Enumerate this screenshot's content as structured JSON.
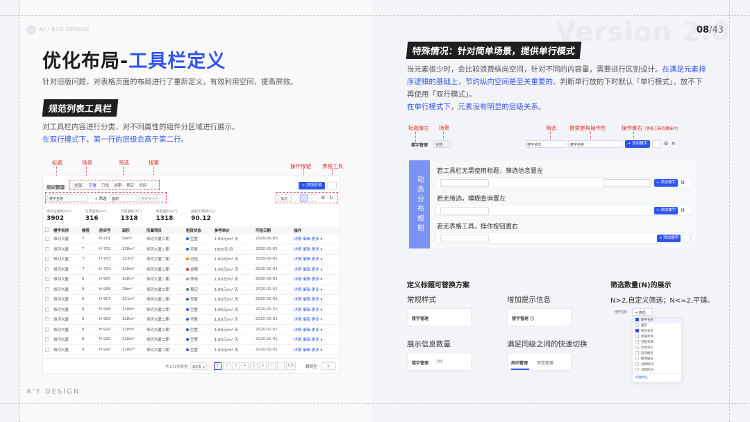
{
  "page": {
    "number": "08",
    "total": "/43",
    "version_watermark": "Version 2.0",
    "brand_watermark": "AI / B2B DESIGN"
  },
  "left": {
    "title_plain": "优化布局-",
    "title_blue": "工具栏定义",
    "intro": "针对旧版问题，对表格页面的布局进行了重新定义，有效利用空间，提高屏效。",
    "section_tag": "规范列表工具栏",
    "section_desc": "对工具栏内容进行分类，对不同属性的组件分区域进行展示。",
    "section_desc_blue": "在双行模式下，第一行的层级会高于第二行。",
    "annotations": {
      "title": "标题",
      "scene": "场景",
      "filter": "筛选",
      "search": "搜索",
      "action": "操作按钮",
      "table_tool": "表格工具"
    },
    "mock": {
      "title": "房间管理",
      "scene_tabs": [
        "全部",
        "空置",
        "已租",
        "逾期",
        "预定",
        "停用"
      ],
      "add_btn": "+ 添加房源",
      "filter_btn": "+ 筛选",
      "filter_chips": [
        "楼宇名称",
        "面积"
      ],
      "search_placeholder": "搜索房间号",
      "batch_btn": "批次",
      "stats": [
        {
          "label": "房间总面积(m²)",
          "value": "3902"
        },
        {
          "label": "空置面积(m²)",
          "value": "316"
        },
        {
          "label": "已租面积(m²)",
          "value": "1318"
        },
        {
          "label": "房租面积(m²)",
          "value": "1318"
        },
        {
          "label": "面积出租率(%)",
          "value": "90.12"
        }
      ],
      "columns": [
        "楼宇名称",
        "楼层",
        "房间号",
        "面积",
        "所属项目",
        "租赁状态",
        "参考单价",
        "可租日期",
        "操作"
      ],
      "rows": [
        [
          "恒河大厦",
          "7",
          "H-701",
          "38m²",
          "恒河大厦二期",
          "空置",
          "1.80元/m²·天",
          "2020-01-03"
        ],
        [
          "恒河大厦",
          "7",
          "H-702",
          "128m²",
          "恒河大厦二期",
          "空置",
          "1800元/月",
          "2020-01-01"
        ],
        [
          "恒河大厦",
          "7",
          "H-703",
          "123m²",
          "恒河大厦二期",
          "已租",
          "1.80元/m²·天",
          "2020-01-01"
        ],
        [
          "恒河大厦",
          "7",
          "H-704",
          "128m²",
          "恒河大厦二期",
          "逾期",
          "1.80元/m²·天",
          "2020-01-01"
        ],
        [
          "恒河大厦",
          "9",
          "H-905",
          "128m²",
          "恒河大厦二期",
          "停用",
          "1.80元/m²·天",
          "2020-01-01"
        ],
        [
          "恒河大厦",
          "9",
          "H-906",
          "28m²",
          "恒河大厦二期",
          "预定",
          "1.80元/m²·天",
          "2020-01-01"
        ],
        [
          "恒河大厦",
          "9",
          "H-907",
          "121m²",
          "恒河大厦二期",
          "空置",
          "1.80元/m²·天",
          "2020-01-01"
        ],
        [
          "恒河大厦",
          "9",
          "H-908",
          "128m²",
          "恒河大厦二期",
          "空置",
          "1.80元/m²·天",
          "2020-01-01"
        ],
        [
          "恒河大厦",
          "9",
          "H-909",
          "128m²",
          "恒河大厦二期",
          "空置",
          "1.80元/m²·天",
          "2020-01-01"
        ],
        [
          "恒河大厦",
          "9",
          "H-910",
          "128m²",
          "恒河大厦二期",
          "空置",
          "1.80元/m²·天",
          "2020-01-01"
        ],
        [
          "恒河大厦",
          "9",
          "H-910",
          "128m²",
          "恒河大厦二期",
          "空置",
          "1.80元/m²·天",
          "2020-01-01"
        ],
        [
          "恒河大厦",
          "9",
          "H-910",
          "128m²",
          "恒河大厦二期",
          "空置",
          "1.80元/m²·天",
          "2020-01-01"
        ]
      ],
      "row_actions": "详情 编辑 更多 ▾",
      "total_text": "共101条数据",
      "page_size": "20/页 ∨",
      "pages": [
        "1",
        "2",
        "3",
        "4",
        "5",
        "6",
        "7",
        "...",
        "100"
      ],
      "jump_label": "跳转至",
      "jump_value": "1"
    },
    "footer_brand": "A'Y DESIGN"
  },
  "status_colors": {
    "空置": "#2f54eb",
    "已租": "#f08c00",
    "逾期": "#e03030",
    "停用": "#999999",
    "预定": "#22a06b"
  },
  "right": {
    "tag": "特殊情况：针对简单场景，提供单行模式",
    "desc1": "当元素很少时，会比较浪费纵向空间，针对不同的内容量，需要进行区别设计。",
    "desc1_blue": "在满足元素排序逻辑的基础上，节约纵向空间是至关重要的。",
    "desc1_tail": "判断单行放的下时默认「单行模式」，放不下再使用「双行模式」。",
    "desc2_blue": "在单行模式下，元素没有明显的层级关系。",
    "annotations": {
      "title_left": "标题置左",
      "scene": "场景",
      "filter": "筛选",
      "search_more": "搜索更具操作性",
      "action_right": "操作置右",
      "action_right_note": "（表格工具同属操作）"
    },
    "single_row": {
      "title": "楼宇管理",
      "scene": "全部",
      "filter_label": "楼宇状态",
      "filter_ph": "请选择",
      "filter2_label": "楼宇名称",
      "search_ph": "请输入关键词",
      "add_btn": "+ 添加楼宇",
      "more": "···"
    },
    "dynamic": {
      "side_label": "动态分布规则",
      "cases": [
        {
          "text": "若工具栏无需使用标题，筛选信息置左"
        },
        {
          "text": "若无筛选，模糊查询置左"
        },
        {
          "text": "若无表格工具，操作按钮置右"
        }
      ]
    },
    "title_section": {
      "heading": "定义标题可替换方案",
      "items": [
        {
          "label": "常规样式",
          "sample": "楼宇管理"
        },
        {
          "label": "增加提示信息",
          "sample": "楼宇管理 ⓘ"
        },
        {
          "label": "展示信息数量",
          "sample": "楼宇管理",
          "count": "99"
        },
        {
          "label": "满足同级之间的快速切换",
          "tab1": "房间管理",
          "tab2": "房态管理"
        }
      ]
    },
    "filter_section": {
      "heading": "筛选数量(N)的展示",
      "desc": "N>2,自定义筛选；N<=2,平铺。",
      "popup_title": "楼宇名称",
      "popup_btn": "+ 筛选",
      "options": [
        "楼宇名称",
        "面积",
        "租赁状态",
        "所属项目",
        "可租日期",
        "参考单价",
        "房间楼层",
        "楼宇编号",
        "创建时间",
        "创建时间"
      ],
      "checked": [
        true,
        false,
        true,
        false,
        false,
        false,
        false,
        false,
        false,
        false
      ],
      "footer_link": "恢复默认"
    }
  }
}
